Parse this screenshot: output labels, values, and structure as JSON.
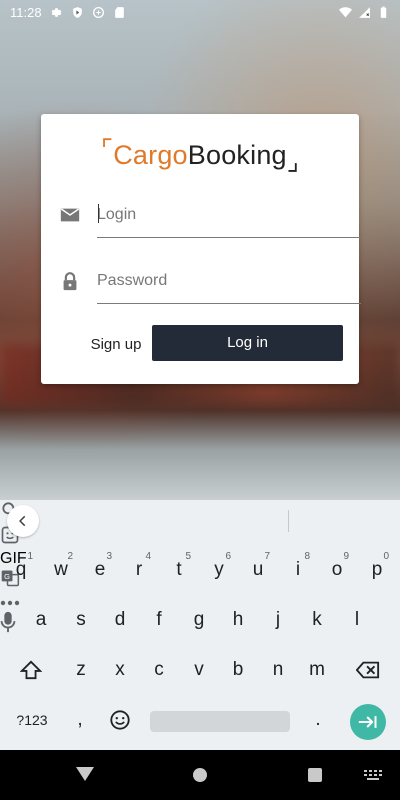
{
  "status_bar": {
    "time": "11:28"
  },
  "app": {
    "logo_part1": "Cargo",
    "logo_part2": "Booking",
    "brand_color": "#e07a2a"
  },
  "form": {
    "login_placeholder": "Login",
    "password_placeholder": "Password",
    "signup_label": "Sign up",
    "login_label": "Log in"
  },
  "keyboard": {
    "toolbar": {
      "gif_label": "GIF"
    },
    "row1": [
      {
        "k": "q",
        "h": "1"
      },
      {
        "k": "w",
        "h": "2"
      },
      {
        "k": "e",
        "h": "3"
      },
      {
        "k": "r",
        "h": "4"
      },
      {
        "k": "t",
        "h": "5"
      },
      {
        "k": "y",
        "h": "6"
      },
      {
        "k": "u",
        "h": "7"
      },
      {
        "k": "i",
        "h": "8"
      },
      {
        "k": "o",
        "h": "9"
      },
      {
        "k": "p",
        "h": "0"
      }
    ],
    "row2": [
      "a",
      "s",
      "d",
      "f",
      "g",
      "h",
      "j",
      "k",
      "l"
    ],
    "row3": [
      "z",
      "x",
      "c",
      "v",
      "b",
      "n",
      "m"
    ],
    "symbols_label": "?123",
    "comma": ",",
    "period": "."
  }
}
